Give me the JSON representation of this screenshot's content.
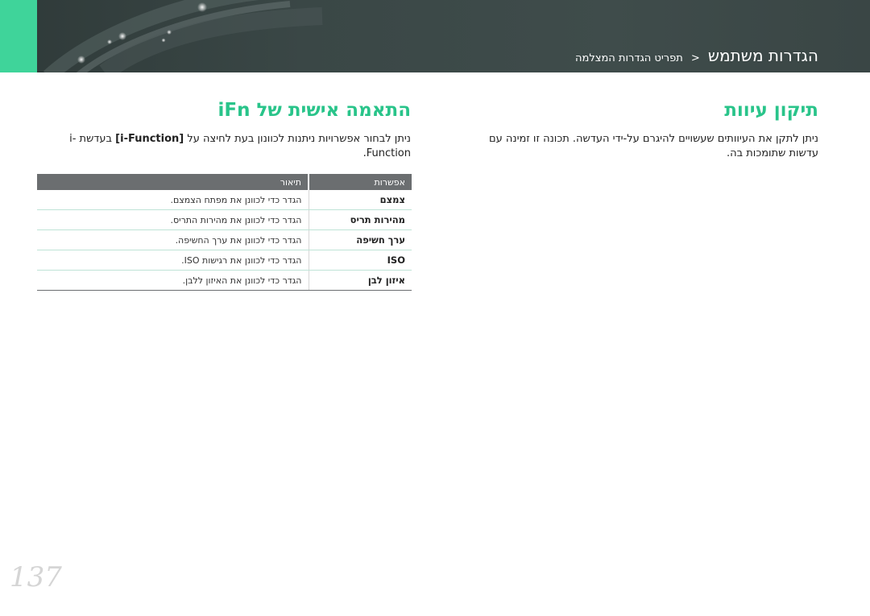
{
  "header": {
    "breadcrumb_parent": "תפריט הגדרות המצלמה",
    "breadcrumb_separator": "<",
    "breadcrumb_current": "הגדרות משתמש",
    "accent_color": "#3fd49a"
  },
  "right_section": {
    "title": "תיקון עיוות",
    "paragraph": "ניתן לתקן את העיוותים שעשויים להיגרם על-ידי העדשה. תכונה זו זמינה עם עדשות שתומכות בה."
  },
  "left_section": {
    "title": "התאמה אישית של iFn",
    "paragraph_before": "ניתן לבחור אפשרויות ניתנות לכוונון בעת לחיצה על",
    "paragraph_key": "[i-Function]",
    "paragraph_after": "בעדשת i-Function.",
    "table": {
      "headers": {
        "option": "אפשרות",
        "description": "תיאור"
      },
      "rows": [
        {
          "option": "צמצם",
          "description": "הגדר כדי לכוונן את מפתח הצמצם."
        },
        {
          "option": "מהירות תריס",
          "description": "הגדר כדי לכוונן את מהירות התריס."
        },
        {
          "option": "ערך חשיפה",
          "description": "הגדר כדי לכוונן את ערך החשיפה."
        },
        {
          "option": "ISO",
          "description": "הגדר כדי לכוונן את רגישות ISO."
        },
        {
          "option": "איזון לבן",
          "description": "הגדר כדי לכוונן את האיזון ללבן."
        }
      ]
    }
  },
  "page_number": "137"
}
